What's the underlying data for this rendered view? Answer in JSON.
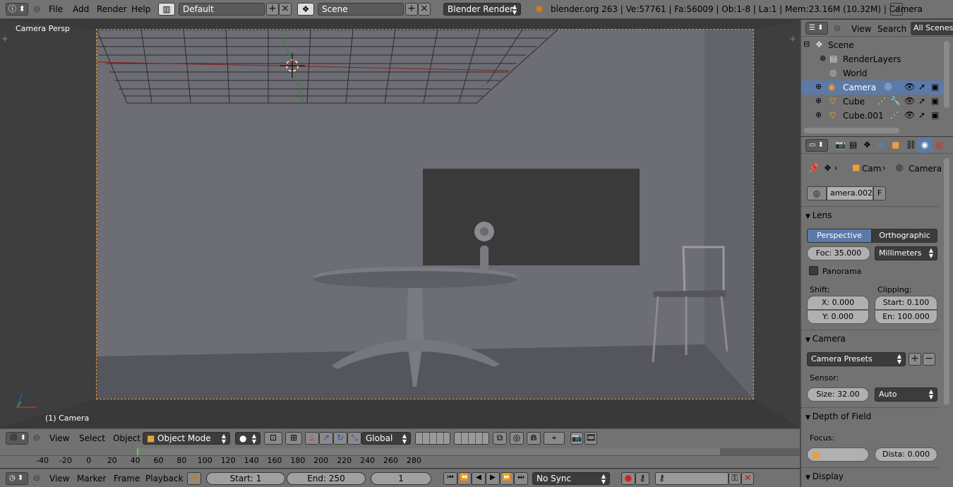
{
  "top_header": {
    "menus": [
      "File",
      "Add",
      "Render",
      "Help"
    ],
    "layout": "Default",
    "scene": "Scene",
    "engine": "Blender Render",
    "status": "blender.org 263 | Ve:57761 | Fa:56009 | Ob:1-8 | La:1 | Mem:23.16M (10.32M) | Camera"
  },
  "viewport": {
    "title": "Camera Persp",
    "object_label": "(1) Camera"
  },
  "viewport_header": {
    "menus": [
      "View",
      "Select",
      "Object"
    ],
    "mode": "Object Mode",
    "orientation": "Global"
  },
  "timeline": {
    "ticks": [
      "-40",
      "-20",
      "0",
      "20",
      "40",
      "60",
      "80",
      "100",
      "120",
      "140",
      "160",
      "180",
      "200",
      "220",
      "240",
      "260",
      "280"
    ]
  },
  "bottom_header": {
    "menus": [
      "View",
      "Marker",
      "Frame",
      "Playback"
    ],
    "start": "Start: 1",
    "end": "End: 250",
    "current_frame": "1",
    "sync": "No Sync"
  },
  "outliner": {
    "menus": [
      "View",
      "Search"
    ],
    "filter": "All Scenes",
    "items": [
      {
        "label": "Scene"
      },
      {
        "label": "RenderLayers"
      },
      {
        "label": "World"
      },
      {
        "label": "Camera"
      },
      {
        "label": "Cube"
      },
      {
        "label": "Cube.001"
      }
    ]
  },
  "properties": {
    "breadcrumb_object": "Cam",
    "breadcrumb_data": "Camera",
    "datablock": "amera.002",
    "fake_user": "F",
    "lens": {
      "title": "Lens",
      "perspective": "Perspective",
      "orthographic": "Orthographic",
      "focal": "Foc: 35.000",
      "units": "Millimeters",
      "panorama": "Panorama",
      "shift_label": "Shift:",
      "shift_x": "X: 0.000",
      "shift_y": "Y: 0.000",
      "clipping_label": "Clipping:",
      "clip_start": "Start: 0.100",
      "clip_end": "En: 100.000"
    },
    "camera": {
      "title": "Camera",
      "presets": "Camera Presets",
      "sensor_label": "Sensor:",
      "size": "Size: 32.00",
      "fit": "Auto"
    },
    "dof": {
      "title": "Depth of Field",
      "focus_label": "Focus:",
      "distance": "Dista: 0.000"
    },
    "display": {
      "title": "Display"
    }
  }
}
